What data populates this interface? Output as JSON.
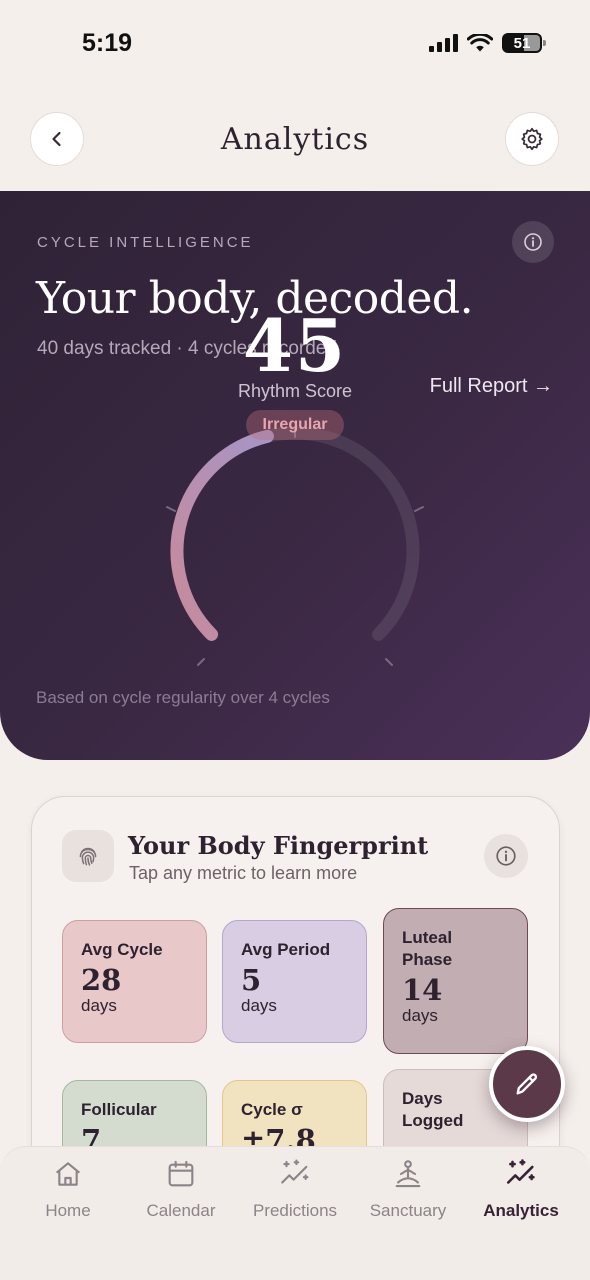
{
  "status_bar": {
    "time": "5:19",
    "battery": "51"
  },
  "header": {
    "title": "Analytics",
    "back_icon": "chevron-left-icon",
    "settings_icon": "gear-icon"
  },
  "hero": {
    "eyebrow": "CYCLE INTELLIGENCE",
    "title": "Your body, decoded.",
    "subtitle": "40 days tracked · 4 cycles recorded",
    "full_report": "Full Report →",
    "score": "45",
    "score_fraction": 0.45,
    "score_label": "Rhythm Score",
    "status_badge": "Irregular",
    "footnote": "Based on cycle regularity over 4 cycles",
    "colors": {
      "bg_start": "#2f2236",
      "bg_end": "#4a3058",
      "arc_start": "#c88a9a",
      "arc_end": "#a595c8"
    }
  },
  "fingerprint": {
    "title": "Your Body Fingerprint",
    "subtitle": "Tap any metric to learn more",
    "metrics": [
      {
        "label": "Avg Cycle",
        "value": "28",
        "unit": "days"
      },
      {
        "label": "Avg Period",
        "value": "5",
        "unit": "days"
      },
      {
        "label": "Luteal Phase",
        "value": "14",
        "unit": "days"
      },
      {
        "label": "Follicular",
        "value": "7",
        "unit": ""
      },
      {
        "label": "Cycle σ",
        "value": "±7.8",
        "unit": ""
      },
      {
        "label": "Days Logged",
        "value": "",
        "unit": ""
      }
    ]
  },
  "fab": {
    "icon": "pencil-icon"
  },
  "tab_bar": {
    "items": [
      {
        "label": "Home",
        "icon": "home-icon"
      },
      {
        "label": "Calendar",
        "icon": "calendar-icon"
      },
      {
        "label": "Predictions",
        "icon": "sparkle-trend-icon"
      },
      {
        "label": "Sanctuary",
        "icon": "meditation-icon"
      },
      {
        "label": "Analytics",
        "icon": "analytics-icon",
        "active": true
      }
    ]
  }
}
